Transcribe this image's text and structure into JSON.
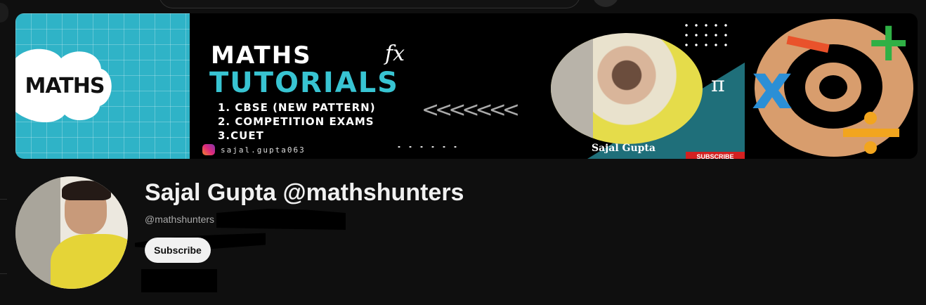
{
  "banner": {
    "cloud_text": "MATHS",
    "title_line1": "MATHS",
    "fx_symbol": "fx",
    "title_line2": "TUTORIALS",
    "list_items": [
      "1. CBSE (NEW PATTERN)",
      "2. COMPETITION EXAMS",
      "3.CUET"
    ],
    "instagram_handle": "sajal.gupta063",
    "chevrons": "<<<<<<<",
    "pi_symbol": "π",
    "photo_caption": "Sajal Gupta",
    "subscribe_tag": "SUBSCRIBE",
    "plus_symbol": "+",
    "times_symbol": "x"
  },
  "channel": {
    "name": "Sajal Gupta @mathshunters",
    "handle": "@mathshunters",
    "subscribe_label": "Subscribe"
  },
  "colors": {
    "background": "#0f0f0f",
    "banner_teal": "#2fb3c7",
    "title_teal": "#38c4d2",
    "subscribe_bg": "#f1f1f1",
    "subscribe_tag_red": "#d32121"
  }
}
